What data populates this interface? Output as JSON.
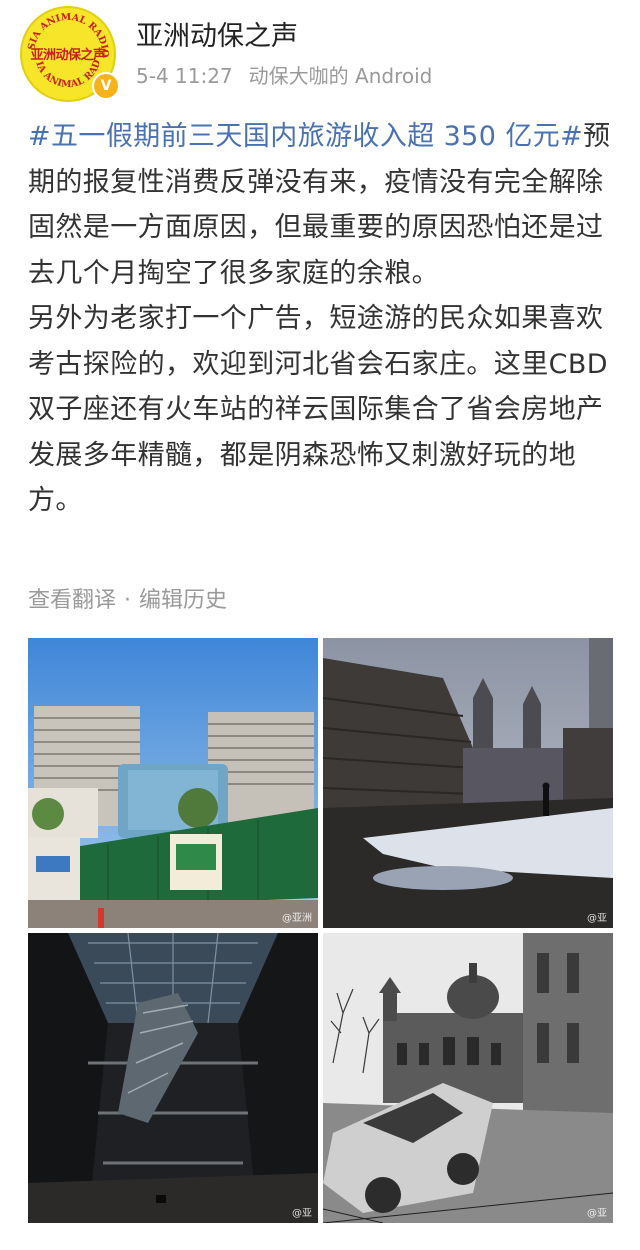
{
  "account": {
    "name": "亚洲动保之声",
    "avatar_text": "亚洲动保之声",
    "avatar_ring_top": "ASIA ANIMAL RADIO",
    "avatar_ring_bottom": "ASIA ANIMAL RADIO",
    "verified_glyph": "V",
    "time": "5-4 11:27",
    "source": "动保大咖的 Android"
  },
  "post": {
    "hashtag": "#五一假期前三天国内旅游收入超 350 亿元#",
    "paragraph1": "预期的报复性消费反弹没有来，疫情没有完全解除固然是一方面原因，但最重要的原因恐怕还是过去几个月掏空了很多家庭的余粮。",
    "paragraph2": "另外为老家打一个广告，短途游的民众如果喜欢考古探险的，欢迎到河北省会石家庄。这里CBD双子座还有火车站的祥云国际集合了省会房地产发展多年精髓，都是阴森恐怖又刺激好玩的地方。"
  },
  "actions": {
    "translate": "查看翻译",
    "separator": "·",
    "edit_history": "编辑历史"
  },
  "photos": [
    {
      "name": "unfinished-twin-towers-photo",
      "watermark": "@亚洲"
    },
    {
      "name": "abandoned-station-snow-photo",
      "watermark": "@亚"
    },
    {
      "name": "abandoned-mall-escalator-photo",
      "watermark": "@亚"
    },
    {
      "name": "abandoned-castle-car-photo",
      "watermark": "@亚"
    }
  ],
  "colors": {
    "hashtag": "#4a72b0",
    "text": "#333333",
    "meta": "#9a9a9a",
    "avatar_bg": "#f7e52a",
    "avatar_text": "#c8201a",
    "verified": "#f6b21b"
  }
}
